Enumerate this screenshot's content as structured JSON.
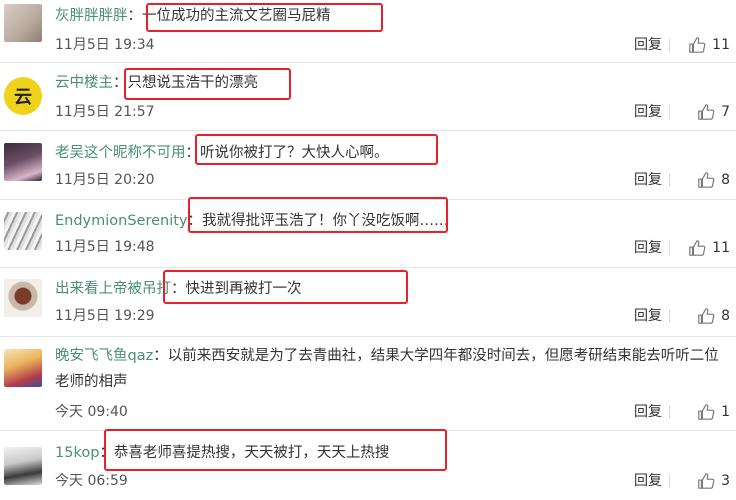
{
  "comments": [
    {
      "name": "灰胖胖胖胖",
      "sep": "：",
      "text": "一位成功的主流文艺圈马屁精",
      "date": "11月5日 19:34",
      "reply": "回复",
      "likes": "11"
    },
    {
      "name": "云中楼主",
      "sep": "：",
      "text": "只想说玉浩干的漂亮",
      "date": "11月5日 21:57",
      "reply": "回复",
      "likes": "7"
    },
    {
      "name": "老吴这个昵称不可用",
      "sep": "：",
      "text": "听说你被打了？大快人心啊。",
      "date": "11月5日 20:20",
      "reply": "回复",
      "likes": "8"
    },
    {
      "name": "EndymionSerenity",
      "sep": "：",
      "text": "我就得批评玉浩了！你丫没吃饭啊……",
      "date": "11月5日 19:48",
      "reply": "回复",
      "likes": "11"
    },
    {
      "name": "出来看上帝被吊打",
      "sep": "：",
      "text": "快进到再被打一次",
      "date": "11月5日 19:29",
      "reply": "回复",
      "likes": "8"
    },
    {
      "name": "晚安飞飞鱼qaz",
      "sep": "：",
      "text": "以前来西安就是为了去青曲社，结果大学四年都没时间去，但愿考研结束能去听听二位老师的相声",
      "date": "今天 09:40",
      "reply": "回复",
      "likes": "1"
    },
    {
      "name": "15kop",
      "sep": "：",
      "text": "恭喜老师喜提热搜，天天被打，天天上热搜",
      "date": "今天 06:59",
      "reply": "回复",
      "likes": "3"
    }
  ],
  "colors": {
    "name": "#4a8f74",
    "highlight": "#e8202a"
  },
  "icons": {
    "like": "thumbs-up-icon"
  }
}
